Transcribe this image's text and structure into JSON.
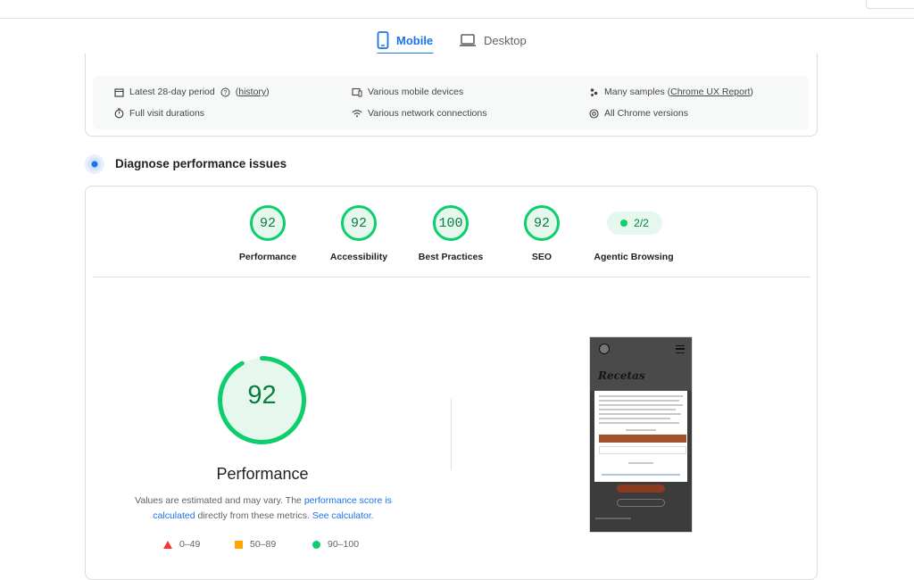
{
  "tabs": [
    {
      "label": "Mobile",
      "icon": "smartphone-icon",
      "active": true
    },
    {
      "label": "Desktop",
      "icon": "laptop-icon",
      "active": false
    }
  ],
  "info": {
    "period_label": "Latest 28-day period",
    "period_link": "history",
    "visits": "Full visit durations",
    "devices": "Various mobile devices",
    "network": "Various network connections",
    "samples_prefix": "Many samples (",
    "samples_link": "Chrome UX Report",
    "samples_suffix": ")",
    "chrome": "All Chrome versions"
  },
  "diagnose": {
    "title": "Diagnose performance issues"
  },
  "scores": [
    {
      "label": "Performance",
      "value": "92"
    },
    {
      "label": "Accessibility",
      "value": "92"
    },
    {
      "label": "Best Practices",
      "value": "100"
    },
    {
      "label": "SEO",
      "value": "92"
    }
  ],
  "agentic": {
    "label": "Agentic Browsing",
    "value": "2/2"
  },
  "performance": {
    "score": "92",
    "score_fraction": 0.92,
    "label": "Performance",
    "note_1": "Values are estimated and may vary. The ",
    "note_link_1": "performance score is calculated",
    "note_2": " directly from these metrics. ",
    "note_link_2": "See calculator",
    "note_3": "."
  },
  "legend": [
    {
      "range": "0–49",
      "color": "#ff3333"
    },
    {
      "range": "50–89",
      "color": "#ffa400"
    },
    {
      "range": "90–100",
      "color": "#0cce6b"
    }
  ],
  "screenshot": {
    "heading": "Recetas"
  },
  "colors": {
    "accent": "#1a73e8",
    "pass": "#0cce6b",
    "pass_text": "#0a7c3f"
  }
}
